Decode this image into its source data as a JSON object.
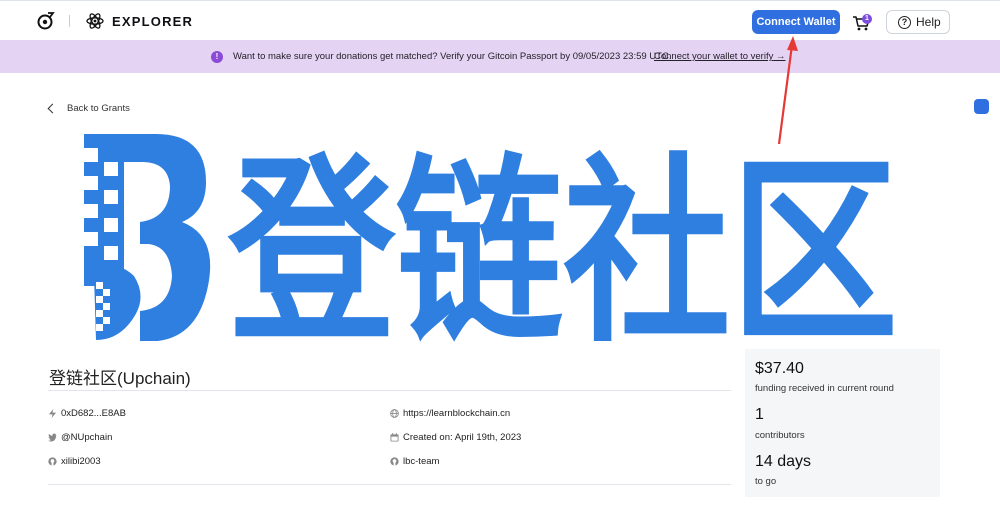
{
  "header": {
    "explorer_label": "EXPLORER",
    "connect_wallet_label": "Connect Wallet",
    "cart_count": "1",
    "help_label": "Help"
  },
  "banner": {
    "message": "Want to make sure your donations get matched? Verify your Gitcoin Passport by 09/05/2023 23:59 UTC.",
    "link_label": "Connect your wallet to verify",
    "accent_color": "#8a4bd6",
    "background_color": "#e5d3f3"
  },
  "nav": {
    "back_label": "Back to Grants"
  },
  "project": {
    "title": "登链社区(Upchain)",
    "banner_text": "登链社区",
    "brand_color": "#2f7fe0",
    "address": "0xD682...E8AB",
    "twitter": "@NUpchain",
    "github_user": "xilibi2003",
    "website": "https://learnblockchain.cn",
    "created_on": "Created on: April 19th, 2023",
    "github_org": "lbc-team"
  },
  "stats": {
    "funding_amount": "$37.40",
    "funding_label": "funding received in current round",
    "contributors_count": "1",
    "contributors_label": "contributors",
    "days_left": "14 days",
    "days_label": "to go"
  },
  "annotation": {
    "arrow_color": "#e53935"
  }
}
